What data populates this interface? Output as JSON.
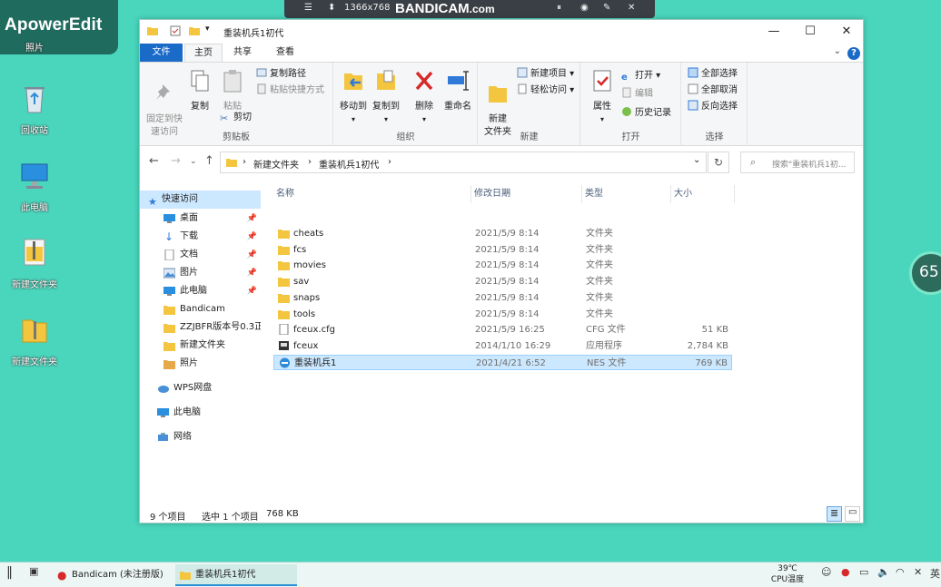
{
  "watermark": {
    "text": "ApowerEdit"
  },
  "recorder": {
    "resolution": "1366x768",
    "brand": "BANDICAM",
    "brand_suffix": ".com"
  },
  "desktop": {
    "icons": [
      {
        "label": "回收站",
        "icon": "recycle-bin-icon"
      },
      {
        "label": "此电脑",
        "icon": "computer-icon"
      },
      {
        "label": "新建文件夹",
        "icon": "zip-folder-icon"
      },
      {
        "label": "新建文件夹",
        "icon": "zip-folder-icon"
      }
    ],
    "top_partial_label": "照片",
    "badge": "65"
  },
  "window": {
    "title": "重装机兵1初代",
    "tabs": {
      "file": "文件",
      "home": "主页",
      "share": "共享",
      "view": "查看"
    },
    "help": "?",
    "ribbon": {
      "clipboard": {
        "label": "剪贴板",
        "pin_quick": "固定到快\n速访问",
        "copy": "复制",
        "paste": "粘贴",
        "copy_path": "复制路径",
        "paste_shortcut": "粘贴快捷方式",
        "cut": "剪切"
      },
      "organize": {
        "label": "组织",
        "move_to": "移动到",
        "copy_to": "复制到",
        "delete": "删除",
        "rename": "重命名"
      },
      "new": {
        "label": "新建",
        "new_folder": "新建\n文件夹",
        "new_item": "新建项目",
        "easy_access": "轻松访问"
      },
      "open": {
        "label": "打开",
        "properties": "属性",
        "open": "打开",
        "edit": "编辑",
        "history": "历史记录"
      },
      "select": {
        "label": "选择",
        "select_all": "全部选择",
        "select_none": "全部取消",
        "invert": "反向选择"
      }
    },
    "address": {
      "crumbs": [
        "新建文件夹",
        "重装机兵1初代"
      ]
    },
    "search": {
      "placeholder": "搜索\"重装机兵1初..."
    },
    "nav": {
      "quick_access": "快速访问",
      "items": [
        {
          "label": "桌面",
          "pinned": true
        },
        {
          "label": "下载",
          "pinned": true
        },
        {
          "label": "文档",
          "pinned": true
        },
        {
          "label": "图片",
          "pinned": true
        },
        {
          "label": "此电脑",
          "pinned": true
        },
        {
          "label": "Bandicam",
          "pinned": false
        },
        {
          "label": "ZZJBFR版本号0.3正",
          "pinned": false
        },
        {
          "label": "新建文件夹",
          "pinned": false
        },
        {
          "label": "照片",
          "pinned": false
        }
      ],
      "wps": "WPS网盘",
      "this_pc": "此电脑",
      "network": "网络",
      "pin_glyph": "📌"
    },
    "columns": {
      "name": "名称",
      "modified": "修改日期",
      "type": "类型",
      "size": "大小"
    },
    "files": [
      {
        "name": "cheats",
        "modified": "2021/5/9 8:14",
        "type": "文件夹",
        "size": "",
        "icon": "folder-icon"
      },
      {
        "name": "fcs",
        "modified": "2021/5/9 8:14",
        "type": "文件夹",
        "size": "",
        "icon": "folder-icon"
      },
      {
        "name": "movies",
        "modified": "2021/5/9 8:14",
        "type": "文件夹",
        "size": "",
        "icon": "folder-icon"
      },
      {
        "name": "sav",
        "modified": "2021/5/9 8:14",
        "type": "文件夹",
        "size": "",
        "icon": "folder-icon"
      },
      {
        "name": "snaps",
        "modified": "2021/5/9 8:14",
        "type": "文件夹",
        "size": "",
        "icon": "folder-icon"
      },
      {
        "name": "tools",
        "modified": "2021/5/9 8:14",
        "type": "文件夹",
        "size": "",
        "icon": "folder-icon"
      },
      {
        "name": "fceux.cfg",
        "modified": "2021/5/9 16:25",
        "type": "CFG 文件",
        "size": "51 KB",
        "icon": "file-icon"
      },
      {
        "name": "fceux",
        "modified": "2014/1/10 16:29",
        "type": "应用程序",
        "size": "2,784 KB",
        "icon": "app-icon"
      },
      {
        "name": "重装机兵1",
        "modified": "2021/4/21 6:52",
        "type": "NES 文件",
        "size": "769 KB",
        "icon": "nes-file-icon",
        "selected": true
      }
    ],
    "status": {
      "count": "9 个项目",
      "selected": "选中 1 个项目",
      "size": "768 KB"
    }
  },
  "taskbar": {
    "items": [
      {
        "label": "Bandicam (未注册版)",
        "active": false
      },
      {
        "label": "重装机兵1初代",
        "active": true
      }
    ],
    "temp": "39℃",
    "temp_label": "CPU温度",
    "ime": "英"
  },
  "colors": {
    "desktop": "#49d6bd",
    "accent": "#1a6ac8",
    "selection": "#cce8ff",
    "folder": "#f4c640"
  }
}
